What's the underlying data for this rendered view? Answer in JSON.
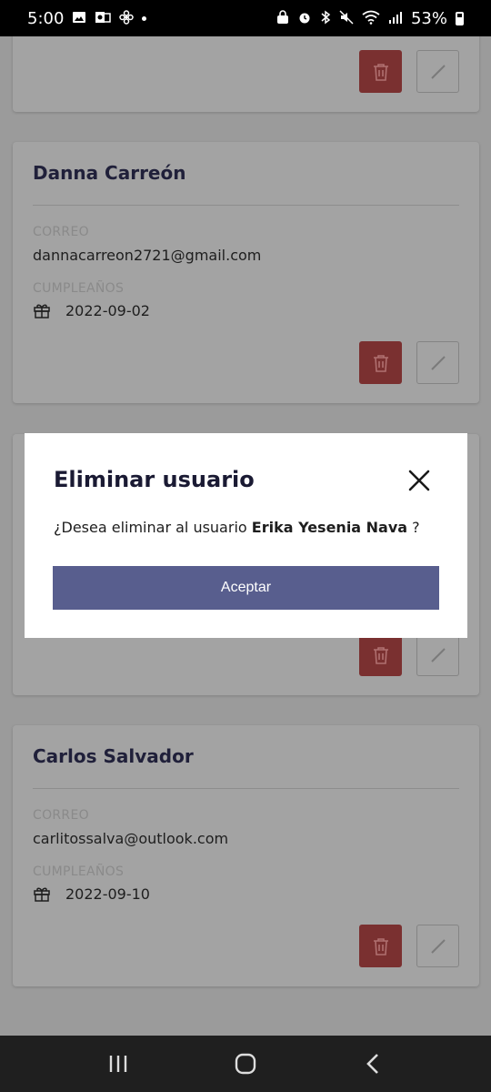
{
  "status_bar": {
    "time": "5:00",
    "battery": "53%",
    "left_icons": [
      "image-icon",
      "outlook-icon",
      "fan-icon"
    ],
    "right_icons": [
      "lock-icon",
      "alarm-icon",
      "bluetooth-icon",
      "mute-icon",
      "wifi-icon",
      "signal-icon",
      "battery-icon"
    ]
  },
  "cards": [
    {
      "name": "Danna Carreón",
      "email_label": "CORREO",
      "email": "dannacarreon2721@gmail.com",
      "birthday_label": "CUMPLEAÑOS",
      "birthday": "2022-09-02"
    },
    {
      "name": "Carlos Salvador",
      "email_label": "CORREO",
      "email": "carlitossalva@outlook.com",
      "birthday_label": "CUMPLEAÑOS",
      "birthday": "2022-09-10"
    }
  ],
  "modal": {
    "title": "Eliminar usuario",
    "message_prefix": "¿Desea eliminar al usuario ",
    "user_name": "Erika Yesenia Nava",
    "message_suffix": " ?",
    "accept_label": "Aceptar"
  },
  "colors": {
    "accent": "#585e8e",
    "delete": "#b54a4a",
    "title": "#1a1a33"
  }
}
